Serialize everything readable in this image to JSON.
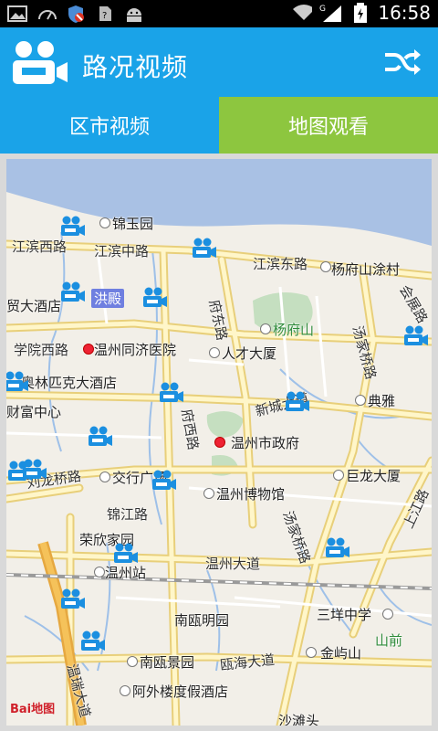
{
  "status_bar": {
    "time": "16:58",
    "network": "G",
    "icons": [
      "image-icon",
      "gauge-icon",
      "shield-icon",
      "sim-icon",
      "android-icon",
      "wifi-icon",
      "signal-icon",
      "battery-icon"
    ]
  },
  "app": {
    "title": "路况视频",
    "logo_icon": "camera-icon",
    "shuffle_icon": "shuffle-icon",
    "brand_color": "#1aa3e8"
  },
  "tabs": [
    {
      "label": "区市视频",
      "active": false,
      "color": "#1aa3e8"
    },
    {
      "label": "地图观看",
      "active": true,
      "color": "#8dc63f"
    }
  ],
  "map": {
    "labels": [
      "锦玉园",
      "江滨西路",
      "江滨中路",
      "江滨东路",
      "杨府山涂村",
      "会展路",
      "贸大酒店",
      "洪殿",
      "府东路",
      "杨府山",
      "汤家桥路",
      "学院西路",
      "温州同济医院",
      "人才大厦",
      "奥林匹克大酒店",
      "典雅",
      "财富中心",
      "新城大道",
      "府西路",
      "温州市政府",
      "刘龙桥路",
      "交行广场",
      "巨龙大厦",
      "温州博物馆",
      "锦江路",
      "汤家桥路",
      "上江路",
      "荣欣家园",
      "温州站",
      "温州大道",
      "三垟中学",
      "南瓯明园",
      "山前",
      "金屿山",
      "南瓯景园",
      "瓯海大道",
      "温瑞大道",
      "阿外楼度假酒店",
      "沙滩头"
    ],
    "attribution": "Bai地图",
    "camera_icon": "video-camera-icon"
  }
}
